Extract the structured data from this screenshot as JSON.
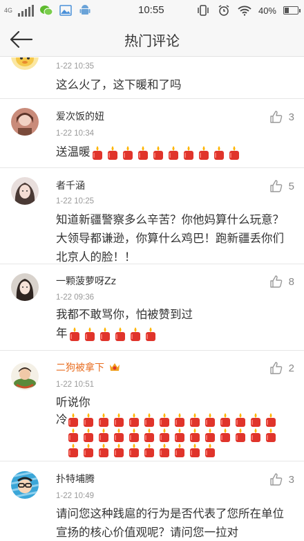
{
  "status_bar": {
    "network": "4G",
    "time": "10:55",
    "battery": "40%",
    "battery_level": 0.4,
    "icons": [
      "signal-icon",
      "wechat-icon",
      "gallery-icon",
      "android-icon",
      "vibrate-icon",
      "alarm-icon",
      "wifi-icon",
      "battery-icon"
    ]
  },
  "nav": {
    "title": "热门评论",
    "back_icon": "back-arrow-icon"
  },
  "comments": [
    {
      "name": "",
      "time": "1-22 10:35",
      "text": "这么火了，这下暖和了吗",
      "likes": "",
      "candles": 0
    },
    {
      "name": "爱次饭的妞",
      "time": "1-22 10:34",
      "text": "送温暖",
      "likes": "3",
      "candles": 10
    },
    {
      "name": "者千涵",
      "time": "1-22 10:25",
      "text": "知道新疆警察多么辛苦？你他妈算什么玩意？大领导都谦逊，你算什么鸡巴！跑新疆丢你们北京人的脸！！",
      "likes": "5",
      "candles": 0
    },
    {
      "name": "一颗菠萝呀Zz",
      "time": "1-22 09:36",
      "text": "我都不敢骂你，怕被赞到过",
      "text2": "年",
      "likes": "8",
      "candles": 6
    },
    {
      "name": "二狗被拿下",
      "time": "1-22 10:51",
      "text": "听说你",
      "text2": "冷",
      "likes": "2",
      "candles": 38
    },
    {
      "name": "扑特埔腾",
      "time": "1-22 10:49",
      "text": "请问您这种践扈的行为是否代表了您所在单位宣扬的核心价值观呢？请问您一拉对",
      "likes": "3",
      "candles": 0
    }
  ],
  "colors": {
    "orange_name": "#e86d20",
    "candle_red": "#e0342b",
    "flame": "#ffb400"
  },
  "icons": {
    "like": "thumbs-up-icon",
    "candle": "candle-emoji-icon",
    "badge": "member-badge-icon"
  }
}
